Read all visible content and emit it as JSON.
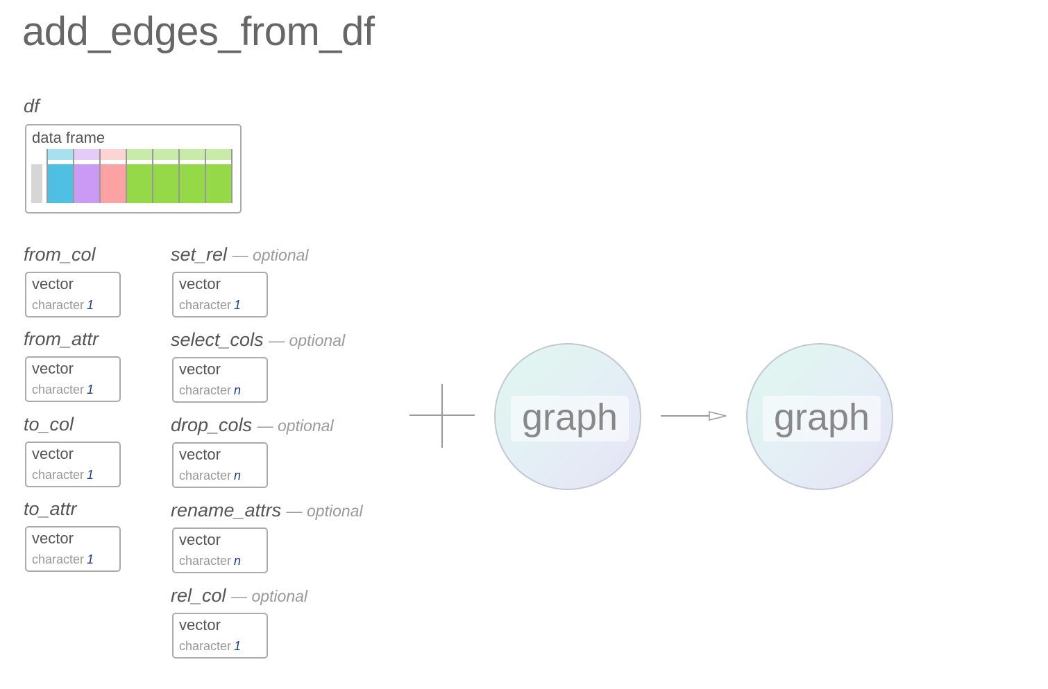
{
  "title": "add_edges_from_df",
  "df": {
    "label": "df",
    "box_type": "data frame",
    "columns": [
      {
        "header_color": "#a6e1f0",
        "body_color": "#4fc0e4"
      },
      {
        "header_color": "#e5cbf7",
        "body_color": "#cb9af5"
      },
      {
        "header_color": "#fcd4d4",
        "body_color": "#fda2a2"
      },
      {
        "header_color": "#c8ebaa",
        "body_color": "#95d848"
      },
      {
        "header_color": "#c8ebaa",
        "body_color": "#95d848"
      },
      {
        "header_color": "#c8ebaa",
        "body_color": "#95d848"
      },
      {
        "header_color": "#c8ebaa",
        "body_color": "#95d848"
      }
    ]
  },
  "args_left": [
    {
      "name": "from_col",
      "type": "vector",
      "subtype": "character",
      "length": "1"
    },
    {
      "name": "from_attr",
      "type": "vector",
      "subtype": "character",
      "length": "1"
    },
    {
      "name": "to_col",
      "type": "vector",
      "subtype": "character",
      "length": "1"
    },
    {
      "name": "to_attr",
      "type": "vector",
      "subtype": "character",
      "length": "1"
    }
  ],
  "args_right": [
    {
      "name": "set_rel",
      "optional": "— optional",
      "type": "vector",
      "subtype": "character",
      "length": "1"
    },
    {
      "name": "select_cols",
      "optional": "— optional",
      "type": "vector",
      "subtype": "character",
      "length": "n"
    },
    {
      "name": "drop_cols",
      "optional": "— optional",
      "type": "vector",
      "subtype": "character",
      "length": "n"
    },
    {
      "name": "rename_attrs",
      "optional": "— optional",
      "type": "vector",
      "subtype": "character",
      "length": "n"
    },
    {
      "name": "rel_col",
      "optional": "— optional",
      "type": "vector",
      "subtype": "character",
      "length": "1"
    }
  ],
  "input_graph": {
    "label": "graph"
  },
  "output_graph": {
    "label": "graph"
  },
  "colors": {
    "line": "#999999",
    "box_border": "#aaaaaa",
    "length_text": "#1a3d7a"
  }
}
